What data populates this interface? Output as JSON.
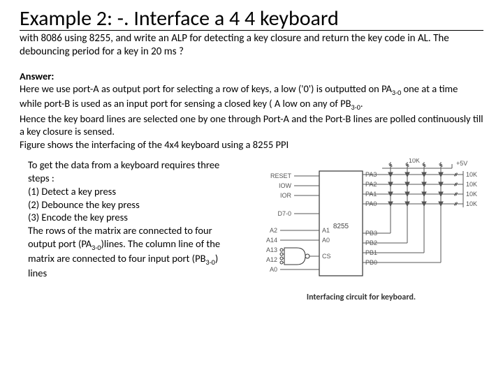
{
  "title": "Example 2: -. Interface a 4 4 keyboard",
  "subtitle": "with 8086 using 8255, and write an ALP for detecting a key closure and return the key code in AL. The debouncing period for a key in 20 ms ?",
  "answer": {
    "label": "Answer:",
    "p1a": "Here we use port-A as output port for selecting a row of keys, a low ('0') is outputted on PA",
    "p1sub": "3-0",
    "p1b": " one at a time",
    "p2a": "while port-B is used as an input port for sensing a closed key ( A low on any of PB",
    "p2sub": "3-0",
    "p2b": ".",
    "p3": "Hence the key board lines are selected one by one through Port-A and the Port-B lines are polled continuously till a key closure is sensed.",
    "p4": "Figure shows the interfacing of the 4x4 keyboard using a 8255 PPI"
  },
  "steps": {
    "s1": "To get the data from a keyboard requires three steps :",
    "s2": "(1)  Detect a key press",
    "s3": "(2)  Debounce the key press",
    "s4": "(3) Encode the key press",
    "s5a": "The rows of the matrix are connected to four output port (PA",
    "s5sub": "3-0",
    "s5b": ")lines. The column line of the matrix are connected to four input port (PB",
    "s5sub2": "3-0",
    "s5c": ") lines"
  },
  "diagram": {
    "chip": "8255",
    "left_signals": [
      "RESET",
      "IOW",
      "IOR",
      "D7-0",
      "A2",
      "A14",
      "A13",
      "A12",
      "A0"
    ],
    "right_pa": [
      "PA3",
      "PA2",
      "PA1",
      "PA0"
    ],
    "right_pb": [
      "PB3",
      "PB2",
      "PB1",
      "PB0"
    ],
    "chip_a": [
      "A1",
      "A0"
    ],
    "cs": "CS",
    "vcc": "+5V",
    "resistors": "10K",
    "caption": "Interfacing circuit for keyboard."
  }
}
